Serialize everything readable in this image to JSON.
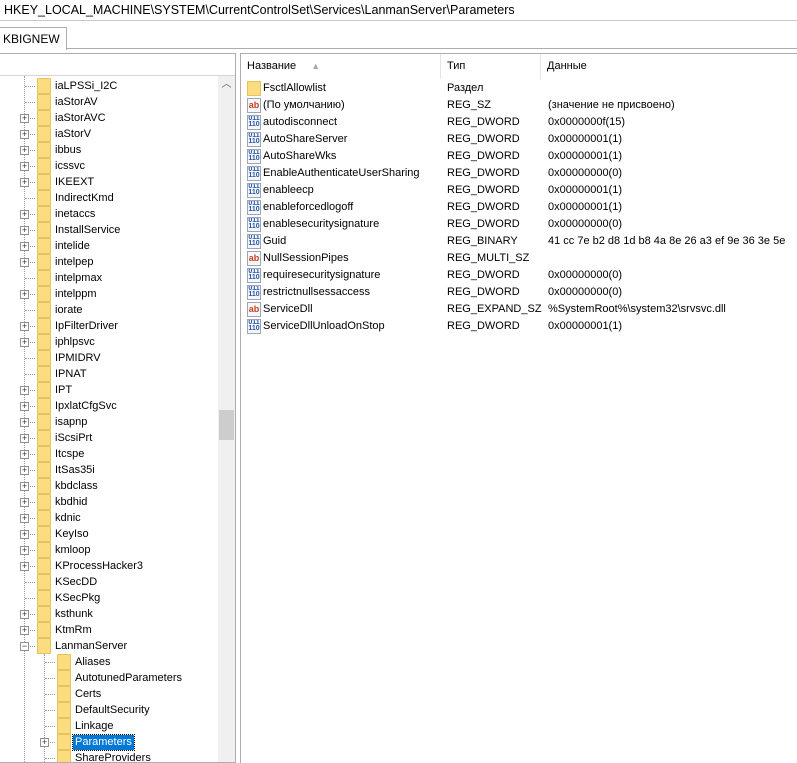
{
  "address": "HKEY_LOCAL_MACHINE\\SYSTEM\\CurrentControlSet\\Services\\LanmanServer\\Parameters",
  "tab": "KBIGNEW",
  "tree": [
    {
      "label": "iaLPSSi_I2C",
      "level": 0,
      "expand": ""
    },
    {
      "label": "iaStorAV",
      "level": 0,
      "expand": ""
    },
    {
      "label": "iaStorAVC",
      "level": 0,
      "expand": "+"
    },
    {
      "label": "iaStorV",
      "level": 0,
      "expand": "+"
    },
    {
      "label": "ibbus",
      "level": 0,
      "expand": "+"
    },
    {
      "label": "icssvc",
      "level": 0,
      "expand": "+"
    },
    {
      "label": "IKEEXT",
      "level": 0,
      "expand": "+"
    },
    {
      "label": "IndirectKmd",
      "level": 0,
      "expand": ""
    },
    {
      "label": "inetaccs",
      "level": 0,
      "expand": "+"
    },
    {
      "label": "InstallService",
      "level": 0,
      "expand": "+"
    },
    {
      "label": "intelide",
      "level": 0,
      "expand": "+"
    },
    {
      "label": "intelpep",
      "level": 0,
      "expand": "+"
    },
    {
      "label": "intelpmax",
      "level": 0,
      "expand": ""
    },
    {
      "label": "intelppm",
      "level": 0,
      "expand": "+"
    },
    {
      "label": "iorate",
      "level": 0,
      "expand": ""
    },
    {
      "label": "IpFilterDriver",
      "level": 0,
      "expand": "+"
    },
    {
      "label": "iphlpsvc",
      "level": 0,
      "expand": "+"
    },
    {
      "label": "IPMIDRV",
      "level": 0,
      "expand": ""
    },
    {
      "label": "IPNAT",
      "level": 0,
      "expand": ""
    },
    {
      "label": "IPT",
      "level": 0,
      "expand": "+"
    },
    {
      "label": "IpxlatCfgSvc",
      "level": 0,
      "expand": "+"
    },
    {
      "label": "isapnp",
      "level": 0,
      "expand": "+"
    },
    {
      "label": "iScsiPrt",
      "level": 0,
      "expand": "+"
    },
    {
      "label": "Itcspe",
      "level": 0,
      "expand": "+"
    },
    {
      "label": "ItSas35i",
      "level": 0,
      "expand": "+"
    },
    {
      "label": "kbdclass",
      "level": 0,
      "expand": "+"
    },
    {
      "label": "kbdhid",
      "level": 0,
      "expand": "+"
    },
    {
      "label": "kdnic",
      "level": 0,
      "expand": "+"
    },
    {
      "label": "KeyIso",
      "level": 0,
      "expand": "+"
    },
    {
      "label": "kmloop",
      "level": 0,
      "expand": "+"
    },
    {
      "label": "KProcessHacker3",
      "level": 0,
      "expand": "+"
    },
    {
      "label": "KSecDD",
      "level": 0,
      "expand": ""
    },
    {
      "label": "KSecPkg",
      "level": 0,
      "expand": ""
    },
    {
      "label": "ksthunk",
      "level": 0,
      "expand": "+"
    },
    {
      "label": "KtmRm",
      "level": 0,
      "expand": "+"
    },
    {
      "label": "LanmanServer",
      "level": 0,
      "expand": "−"
    },
    {
      "label": "Aliases",
      "level": 1,
      "expand": ""
    },
    {
      "label": "AutotunedParameters",
      "level": 1,
      "expand": ""
    },
    {
      "label": "Certs",
      "level": 1,
      "expand": ""
    },
    {
      "label": "DefaultSecurity",
      "level": 1,
      "expand": ""
    },
    {
      "label": "Linkage",
      "level": 1,
      "expand": ""
    },
    {
      "label": "Parameters",
      "level": 1,
      "expand": "+",
      "selected": true
    },
    {
      "label": "ShareProviders",
      "level": 1,
      "expand": ""
    }
  ],
  "columns": {
    "name": "Название",
    "type": "Тип",
    "data": "Данные"
  },
  "values": [
    {
      "icon": "folder",
      "name": "FsctlAllowlist",
      "type": "Раздел",
      "data": ""
    },
    {
      "icon": "ab",
      "name": "(По умолчанию)",
      "type": "REG_SZ",
      "data": "(значение не присвоено)"
    },
    {
      "icon": "bin",
      "name": "autodisconnect",
      "type": "REG_DWORD",
      "data": "0x0000000f(15)"
    },
    {
      "icon": "bin",
      "name": "AutoShareServer",
      "type": "REG_DWORD",
      "data": "0x00000001(1)"
    },
    {
      "icon": "bin",
      "name": "AutoShareWks",
      "type": "REG_DWORD",
      "data": "0x00000001(1)"
    },
    {
      "icon": "bin",
      "name": "EnableAuthenticateUserSharing",
      "type": "REG_DWORD",
      "data": "0x00000000(0)"
    },
    {
      "icon": "bin",
      "name": "enableecp",
      "type": "REG_DWORD",
      "data": "0x00000001(1)"
    },
    {
      "icon": "bin",
      "name": "enableforcedlogoff",
      "type": "REG_DWORD",
      "data": "0x00000001(1)"
    },
    {
      "icon": "bin",
      "name": "enablesecuritysignature",
      "type": "REG_DWORD",
      "data": "0x00000000(0)"
    },
    {
      "icon": "bin",
      "name": "Guid",
      "type": "REG_BINARY",
      "data": "41 cc 7e b2 d8 1d b8 4a 8e 26 a3 ef 9e 36 3e 5e"
    },
    {
      "icon": "ab",
      "name": "NullSessionPipes",
      "type": "REG_MULTI_SZ",
      "data": ""
    },
    {
      "icon": "bin",
      "name": "requiresecuritysignature",
      "type": "REG_DWORD",
      "data": "0x00000000(0)"
    },
    {
      "icon": "bin",
      "name": "restrictnullsessaccess",
      "type": "REG_DWORD",
      "data": "0x00000000(0)"
    },
    {
      "icon": "ab",
      "name": "ServiceDll",
      "type": "REG_EXPAND_SZ",
      "data": "%SystemRoot%\\system32\\srvsvc.dll"
    },
    {
      "icon": "bin",
      "name": "ServiceDllUnloadOnStop",
      "type": "REG_DWORD",
      "data": "0x00000001(1)"
    }
  ]
}
